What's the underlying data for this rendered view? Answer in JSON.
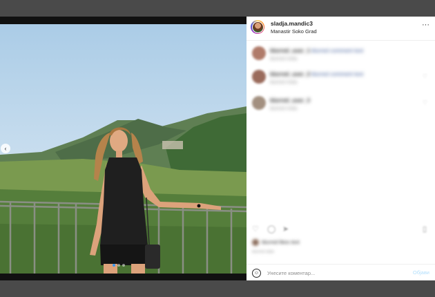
{
  "header": {
    "username": "sladja.mandic3",
    "location": "Manastir Soko Grad",
    "more_icon": "more-horizontal-icon"
  },
  "comments": [
    {
      "user": "blurred_user_1",
      "text": "blurred comment text",
      "meta": "blurred meta"
    },
    {
      "user": "blurred_user_2",
      "text": "blurred comment text",
      "meta": "blurred meta"
    },
    {
      "user": "blurred_user_3",
      "text": "",
      "meta": "blurred meta"
    }
  ],
  "actions": {
    "icons": [
      "heart-icon",
      "comment-icon",
      "share-icon",
      "bookmark-icon"
    ]
  },
  "likes": {
    "text": "blurred likes text"
  },
  "timestamp": "blurred date",
  "comment_bar": {
    "placeholder": "Унесите коментар...",
    "post_label": "Објави",
    "emoji_icon": "emoji-icon"
  },
  "colors": {
    "overlay": "#4a4a4a",
    "link": "#3d5a98",
    "post_disabled": "#b2dffc"
  }
}
